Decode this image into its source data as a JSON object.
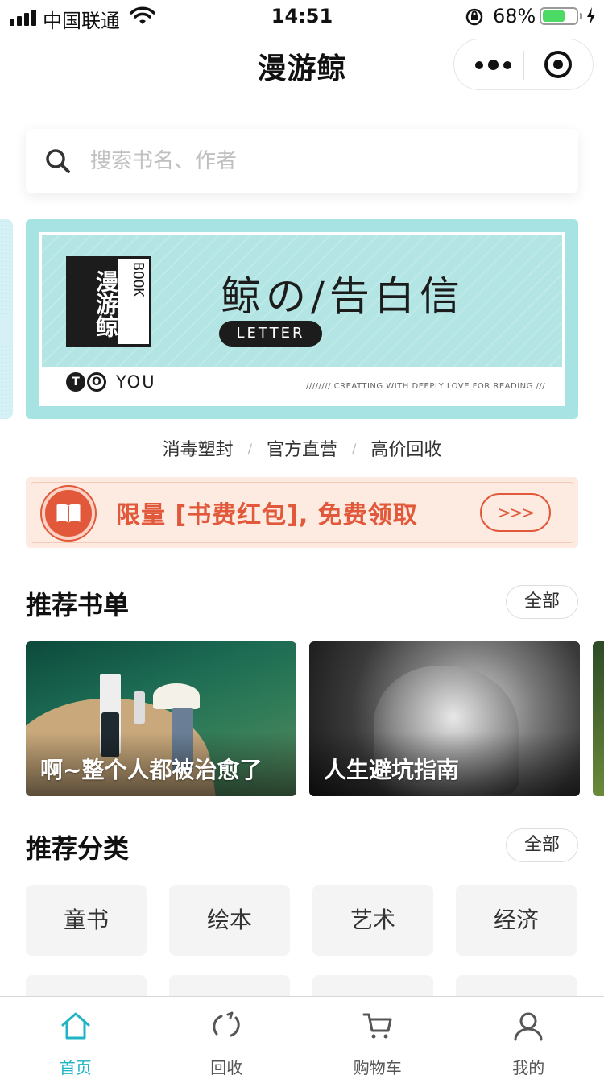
{
  "status_bar": {
    "carrier": "中国联通",
    "time": "14:51",
    "battery_percent": "68%",
    "battery_level": 0.68
  },
  "nav": {
    "title": "漫游鲸"
  },
  "search": {
    "placeholder": "搜索书名、作者"
  },
  "banner": {
    "logo_text": "漫游鲸",
    "logo_book": "BOOK",
    "title": "鲸の/告白信",
    "pill": "LETTER",
    "to_letter_t": "T",
    "to_letter_o": "O",
    "you": "YOU",
    "tagline": "//////// CREATTING WITH DEEPLY LOVE FOR READING ///"
  },
  "slogans": [
    "消毒塑封",
    "官方直营",
    "高价回收"
  ],
  "slogan_separator": "/",
  "promo": {
    "text": "限量 [书费红包], 免费领取",
    "arrow": ">>>"
  },
  "book_lists": {
    "title": "推荐书单",
    "all_label": "全部",
    "items": [
      {
        "label": "啊~整个人都被治愈了"
      },
      {
        "label": "人生避坑指南"
      }
    ]
  },
  "categories": {
    "title": "推荐分类",
    "all_label": "全部",
    "items": [
      "童书",
      "绘本",
      "艺术",
      "经济"
    ]
  },
  "tab_bar": {
    "items": [
      {
        "label": "首页",
        "icon": "home-icon",
        "active": true
      },
      {
        "label": "回收",
        "icon": "recycle-icon",
        "active": false
      },
      {
        "label": "购物车",
        "icon": "cart-icon",
        "active": false
      },
      {
        "label": "我的",
        "icon": "user-icon",
        "active": false
      }
    ]
  },
  "colors": {
    "accent": "#1fb5c4",
    "promo": "#e2583a",
    "banner_bg": "#a7e3e3",
    "battery": "#4cd964"
  }
}
